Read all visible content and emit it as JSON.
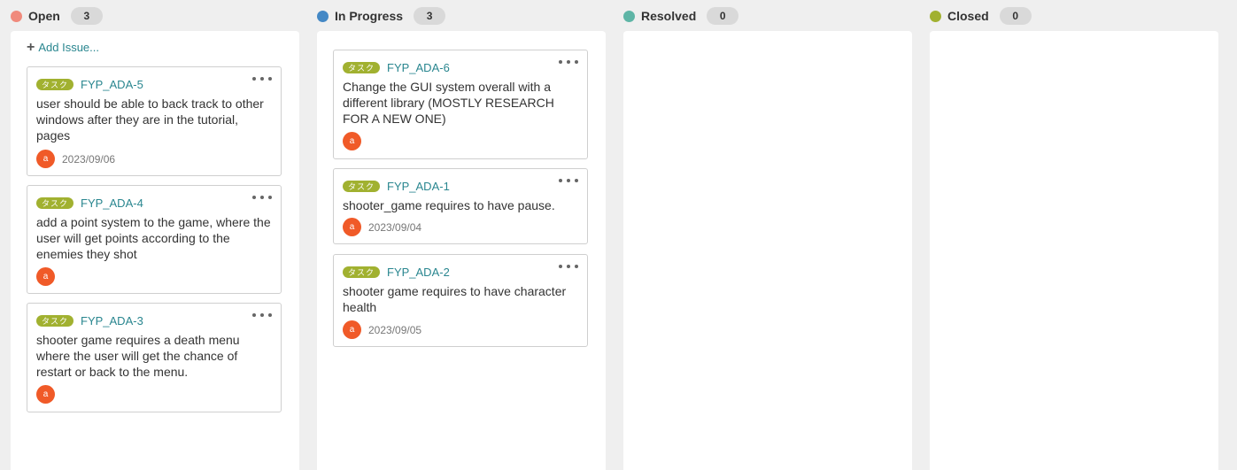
{
  "columns": [
    {
      "title": "Open",
      "count": "3",
      "color": "#f08a7c",
      "add_issue_label": "Add Issue...",
      "cards": [
        {
          "tag": "タスク",
          "key": "FYP_ADA-5",
          "summary": "user should be able to back track to other windows after they are in the tutorial, pages",
          "avatar": "a",
          "date": "2023/09/06"
        },
        {
          "tag": "タスク",
          "key": "FYP_ADA-4",
          "summary": "add a point system to the game, where the user will get points according to the enemies they shot",
          "avatar": "a",
          "date": ""
        },
        {
          "tag": "タスク",
          "key": "FYP_ADA-3",
          "summary": "shooter game requires a death menu where the user will get the chance of restart or back to the menu.",
          "avatar": "a",
          "date": ""
        }
      ]
    },
    {
      "title": "In Progress",
      "count": "3",
      "color": "#4488c5",
      "cards": [
        {
          "tag": "タスク",
          "key": "FYP_ADA-6",
          "summary": "Change the GUI system overall with a different library (MOSTLY RESEARCH FOR A NEW ONE)",
          "avatar": "a",
          "date": ""
        },
        {
          "tag": "タスク",
          "key": "FYP_ADA-1",
          "summary": "shooter_game requires to have pause.",
          "avatar": "a",
          "date": "2023/09/04"
        },
        {
          "tag": "タスク",
          "key": "FYP_ADA-2",
          "summary": "shooter game requires to have character health",
          "avatar": "a",
          "date": "2023/09/05"
        }
      ]
    },
    {
      "title": "Resolved",
      "count": "0",
      "color": "#5eb5a6",
      "cards": []
    },
    {
      "title": "Closed",
      "count": "0",
      "color": "#a1b130",
      "cards": []
    }
  ],
  "icons": {
    "add": "plus-icon",
    "more": "more-horizontal-icon",
    "status": "status-dot-icon"
  }
}
